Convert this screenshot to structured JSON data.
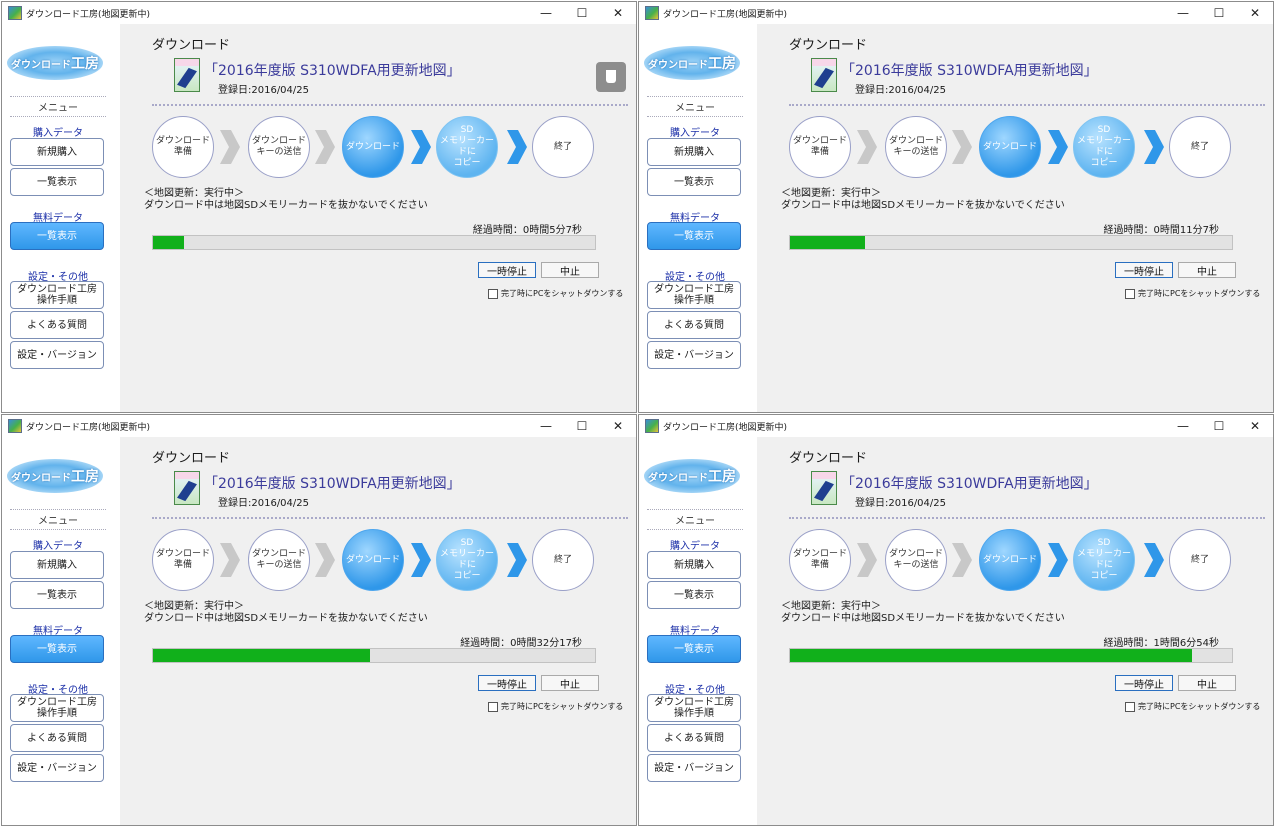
{
  "colors": {
    "accent_blue": "#2f97e9",
    "progress_green": "#11b01b",
    "progress_track": "#e2e2e2",
    "title_purple": "#3b3b9b",
    "section_label_blue": "#1b2fa8"
  },
  "windows": [
    {
      "title": "ダウンロード工房(地図更新中)",
      "controls": {
        "minimize": "—",
        "maximize": "☐",
        "close": "✕"
      },
      "logo": {
        "text": "ダウンロード",
        "text_big": "工房"
      },
      "sidebar": {
        "menu_label": "メニュー",
        "purchase_label": "購入データ",
        "new_purchase": "新規購入",
        "list_view": "一覧表示",
        "free_label": "無料データ",
        "free_list": "一覧表示",
        "settings_label": "設定・その他",
        "manual_line1": "ダウンロード工房",
        "manual_line2": "操作手順",
        "faq": "よくある質問",
        "settings_version": "設定・バージョン"
      },
      "heading": "ダウンロード",
      "map_icon_name": "map-data-icon",
      "map_icon_label": "更新地図",
      "map_title": "「2016年度版 S310WDFA用更新地図」",
      "reg_date": "登録日:2016/04/25",
      "show_usb_icon": true,
      "steps": [
        {
          "line1": "ダウンロード",
          "line2": "準備",
          "state": "done"
        },
        {
          "line1": "ダウンロード",
          "line2": "キーの送信",
          "state": "done"
        },
        {
          "line1": "ダウンロード",
          "line2": "",
          "state": "current"
        },
        {
          "line1": "SD",
          "line2": "メモリーカードに",
          "line3": "コピー",
          "state": "next"
        },
        {
          "line1": "終了",
          "line2": "",
          "state": "pending"
        }
      ],
      "status_line1": "＜地図更新：実行中＞",
      "status_line2": "ダウンロード中は地図SDメモリーカードを抜かないでください",
      "elapsed": "経過時間：0時間5分7秒",
      "progress": 0.07,
      "pause_button": "一時停止",
      "stop_button": "中止",
      "shutdown_checkbox": "完了時にPCをシャットダウンする"
    },
    {
      "title": "ダウンロード工房(地図更新中)",
      "controls": {
        "minimize": "—",
        "maximize": "☐",
        "close": "✕"
      },
      "logo": {
        "text": "ダウンロード",
        "text_big": "工房"
      },
      "sidebar": {
        "menu_label": "メニュー",
        "purchase_label": "購入データ",
        "new_purchase": "新規購入",
        "list_view": "一覧表示",
        "free_label": "無料データ",
        "free_list": "一覧表示",
        "settings_label": "設定・その他",
        "manual_line1": "ダウンロード工房",
        "manual_line2": "操作手順",
        "faq": "よくある質問",
        "settings_version": "設定・バージョン"
      },
      "heading": "ダウンロード",
      "map_icon_name": "map-data-icon",
      "map_icon_label": "更新地図",
      "map_title": "「2016年度版 S310WDFA用更新地図」",
      "reg_date": "登録日:2016/04/25",
      "show_usb_icon": false,
      "steps": [
        {
          "line1": "ダウンロード",
          "line2": "準備",
          "state": "done"
        },
        {
          "line1": "ダウンロード",
          "line2": "キーの送信",
          "state": "done"
        },
        {
          "line1": "ダウンロード",
          "line2": "",
          "state": "current"
        },
        {
          "line1": "SD",
          "line2": "メモリーカードに",
          "line3": "コピー",
          "state": "next"
        },
        {
          "line1": "終了",
          "line2": "",
          "state": "pending"
        }
      ],
      "status_line1": "＜地図更新：実行中＞",
      "status_line2": "ダウンロード中は地図SDメモリーカードを抜かないでください",
      "elapsed": "経過時間：0時間11分7秒",
      "progress": 0.17,
      "pause_button": "一時停止",
      "stop_button": "中止",
      "shutdown_checkbox": "完了時にPCをシャットダウンする"
    },
    {
      "title": "ダウンロード工房(地図更新中)",
      "controls": {
        "minimize": "—",
        "maximize": "☐",
        "close": "✕"
      },
      "logo": {
        "text": "ダウンロード",
        "text_big": "工房"
      },
      "sidebar": {
        "menu_label": "メニュー",
        "purchase_label": "購入データ",
        "new_purchase": "新規購入",
        "list_view": "一覧表示",
        "free_label": "無料データ",
        "free_list": "一覧表示",
        "settings_label": "設定・その他",
        "manual_line1": "ダウンロード工房",
        "manual_line2": "操作手順",
        "faq": "よくある質問",
        "settings_version": "設定・バージョン"
      },
      "heading": "ダウンロード",
      "map_icon_name": "map-data-icon",
      "map_icon_label": "更新地図",
      "map_title": "「2016年度版 S310WDFA用更新地図」",
      "reg_date": "登録日:2016/04/25",
      "show_usb_icon": false,
      "steps": [
        {
          "line1": "ダウンロード",
          "line2": "準備",
          "state": "done"
        },
        {
          "line1": "ダウンロード",
          "line2": "キーの送信",
          "state": "done"
        },
        {
          "line1": "ダウンロード",
          "line2": "",
          "state": "current"
        },
        {
          "line1": "SD",
          "line2": "メモリーカードに",
          "line3": "コピー",
          "state": "next"
        },
        {
          "line1": "終了",
          "line2": "",
          "state": "pending"
        }
      ],
      "status_line1": "＜地図更新：実行中＞",
      "status_line2": "ダウンロード中は地図SDメモリーカードを抜かないでください",
      "elapsed": "経過時間：0時間32分17秒",
      "progress": 0.49,
      "pause_button": "一時停止",
      "stop_button": "中止",
      "shutdown_checkbox": "完了時にPCをシャットダウンする"
    },
    {
      "title": "ダウンロード工房(地図更新中)",
      "controls": {
        "minimize": "—",
        "maximize": "☐",
        "close": "✕"
      },
      "logo": {
        "text": "ダウンロード",
        "text_big": "工房"
      },
      "sidebar": {
        "menu_label": "メニュー",
        "purchase_label": "購入データ",
        "new_purchase": "新規購入",
        "list_view": "一覧表示",
        "free_label": "無料データ",
        "free_list": "一覧表示",
        "settings_label": "設定・その他",
        "manual_line1": "ダウンロード工房",
        "manual_line2": "操作手順",
        "faq": "よくある質問",
        "settings_version": "設定・バージョン"
      },
      "heading": "ダウンロード",
      "map_icon_name": "map-data-icon",
      "map_icon_label": "更新地図",
      "map_title": "「2016年度版 S310WDFA用更新地図」",
      "reg_date": "登録日:2016/04/25",
      "show_usb_icon": false,
      "steps": [
        {
          "line1": "ダウンロード",
          "line2": "準備",
          "state": "done"
        },
        {
          "line1": "ダウンロード",
          "line2": "キーの送信",
          "state": "done"
        },
        {
          "line1": "ダウンロード",
          "line2": "",
          "state": "current"
        },
        {
          "line1": "SD",
          "line2": "メモリーカードに",
          "line3": "コピー",
          "state": "next"
        },
        {
          "line1": "終了",
          "line2": "",
          "state": "pending"
        }
      ],
      "status_line1": "＜地図更新：実行中＞",
      "status_line2": "ダウンロード中は地図SDメモリーカードを抜かないでください",
      "elapsed": "経過時間：1時間6分54秒",
      "progress": 0.91,
      "pause_button": "一時停止",
      "stop_button": "中止",
      "shutdown_checkbox": "完了時にPCをシャットダウンする"
    }
  ]
}
